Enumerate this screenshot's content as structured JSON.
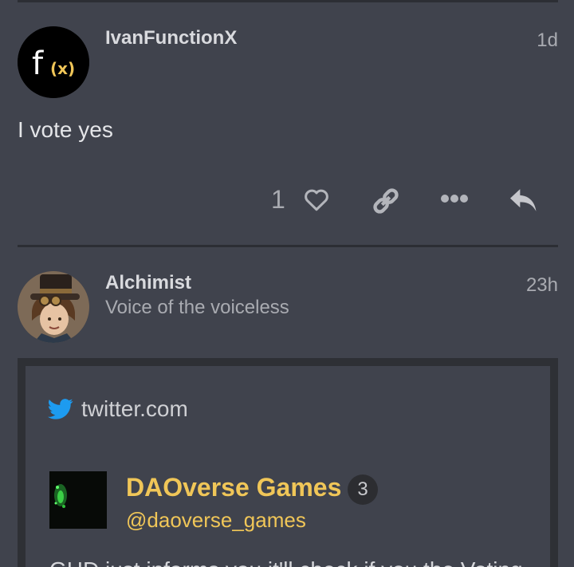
{
  "posts": [
    {
      "username": "IvanFunctionX",
      "time": "1d",
      "avatar_text": "f",
      "avatar_sub": "(x)",
      "body": "I vote yes",
      "like_count": "1"
    },
    {
      "username": "Alchimist",
      "title": "Voice of the voiceless",
      "time": "23h"
    }
  ],
  "onebox": {
    "source_icon": "twitter-bird-icon",
    "domain": "twitter.com",
    "name": "DAOverse Games",
    "badge": "3",
    "handle": "@daoverse_games",
    "text_partial": "GHD just informs you it'll check if you the Voting"
  },
  "icons": {
    "like": "heart-icon",
    "link": "link-icon",
    "more": "more-dots-icon",
    "reply": "reply-icon"
  },
  "colors": {
    "background": "#40434d",
    "accent_yellow": "#f0c658",
    "twitter_blue": "#1d9bf0"
  }
}
